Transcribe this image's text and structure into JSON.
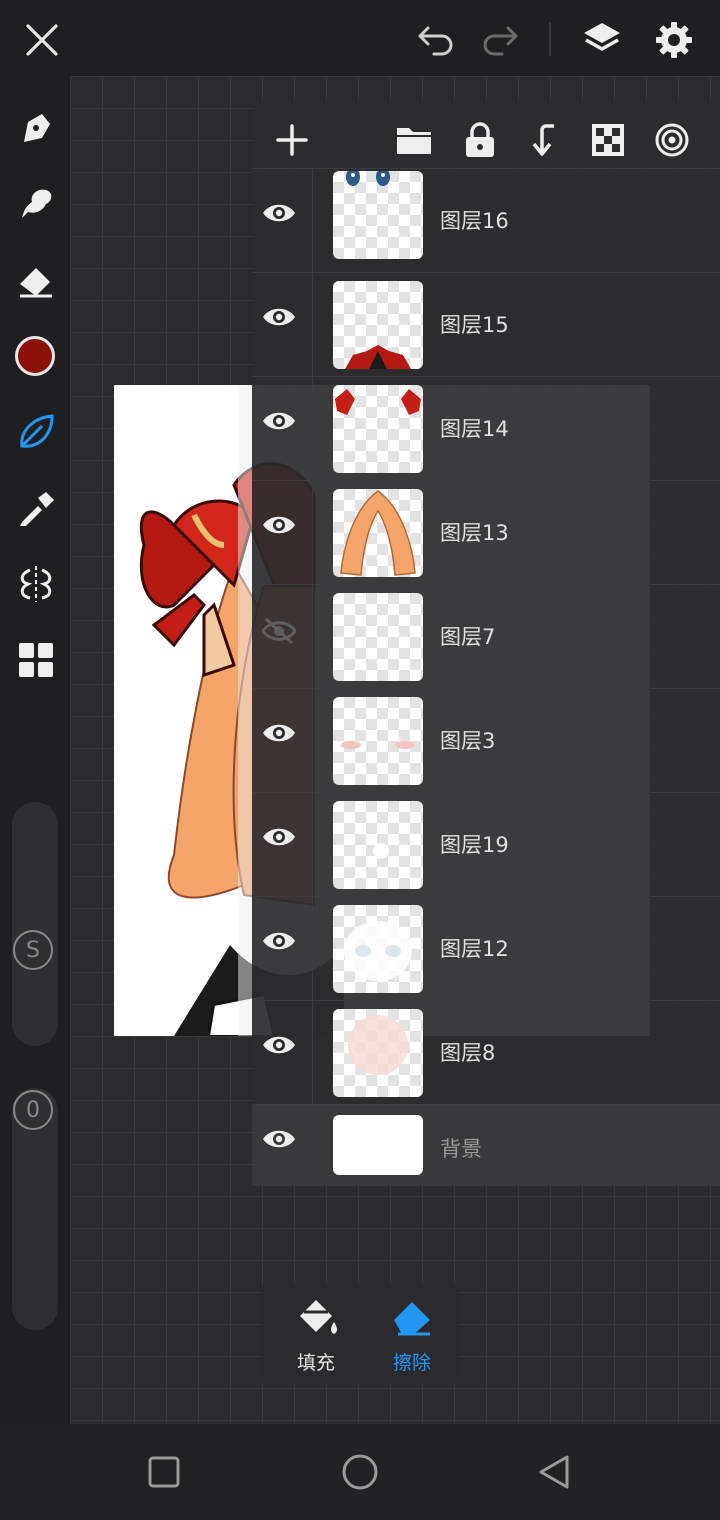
{
  "app": {
    "colors": {
      "accent": "#2196f3",
      "current_color": "#8a1208",
      "panel": "#2c2c2e",
      "background": "#1f1f21"
    }
  },
  "topbar": {
    "icons": [
      "close-icon",
      "undo-icon",
      "redo-icon",
      "layers-icon",
      "settings-icon"
    ]
  },
  "left_toolbar": {
    "tools": [
      "pen-tool-icon",
      "smudge-icon",
      "eraser-icon",
      "color-swatch",
      "leaf-brush-icon",
      "eyedropper-icon",
      "symmetry-icon",
      "grid-icon"
    ],
    "size_label": "S",
    "opacity_label": "0"
  },
  "layers_panel": {
    "toolbar_icons": [
      "add-icon",
      "folder-icon",
      "lock-icon",
      "merge-down-icon",
      "transparency-icon",
      "target-icon"
    ],
    "layers": [
      {
        "name": "图层16",
        "visible": true
      },
      {
        "name": "图层15",
        "visible": true
      },
      {
        "name": "图层14",
        "visible": true
      },
      {
        "name": "图层13",
        "visible": true
      },
      {
        "name": "图层7",
        "visible": false
      },
      {
        "name": "图层3",
        "visible": true
      },
      {
        "name": "图层19",
        "visible": true
      },
      {
        "name": "图层12",
        "visible": true
      },
      {
        "name": "图层8",
        "visible": true
      }
    ],
    "background_layer": {
      "name": "背景",
      "visible": true
    }
  },
  "tool_popup": {
    "fill_label": "填充",
    "erase_label": "擦除",
    "active": "erase"
  },
  "navbar": {
    "icons": [
      "recent-apps-icon",
      "home-icon",
      "back-icon"
    ]
  }
}
